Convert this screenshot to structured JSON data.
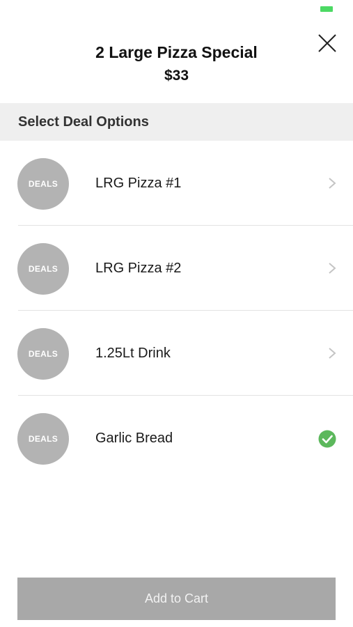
{
  "status_bar": {
    "battery_color": "#4cd964"
  },
  "header": {
    "title": "2 Large Pizza Special",
    "price": "$33",
    "close_icon": "close-icon"
  },
  "section": {
    "title": "Select Deal Options"
  },
  "options": [
    {
      "badge": "DEALS",
      "label": "LRG Pizza #1",
      "trailing_icon": "chevron-right-icon",
      "selected": false
    },
    {
      "badge": "DEALS",
      "label": "LRG Pizza #2",
      "trailing_icon": "chevron-right-icon",
      "selected": false
    },
    {
      "badge": "DEALS",
      "label": "1.25Lt Drink",
      "trailing_icon": "chevron-right-icon",
      "selected": false
    },
    {
      "badge": "DEALS",
      "label": "Garlic Bread",
      "trailing_icon": "check-circle-icon",
      "selected": true
    }
  ],
  "footer": {
    "add_to_cart_label": "Add to Cart"
  },
  "colors": {
    "accent_green": "#5cb85c",
    "avatar_gray": "#b3b3b3",
    "button_gray": "#a8a8a8",
    "section_bg": "#efefef"
  }
}
